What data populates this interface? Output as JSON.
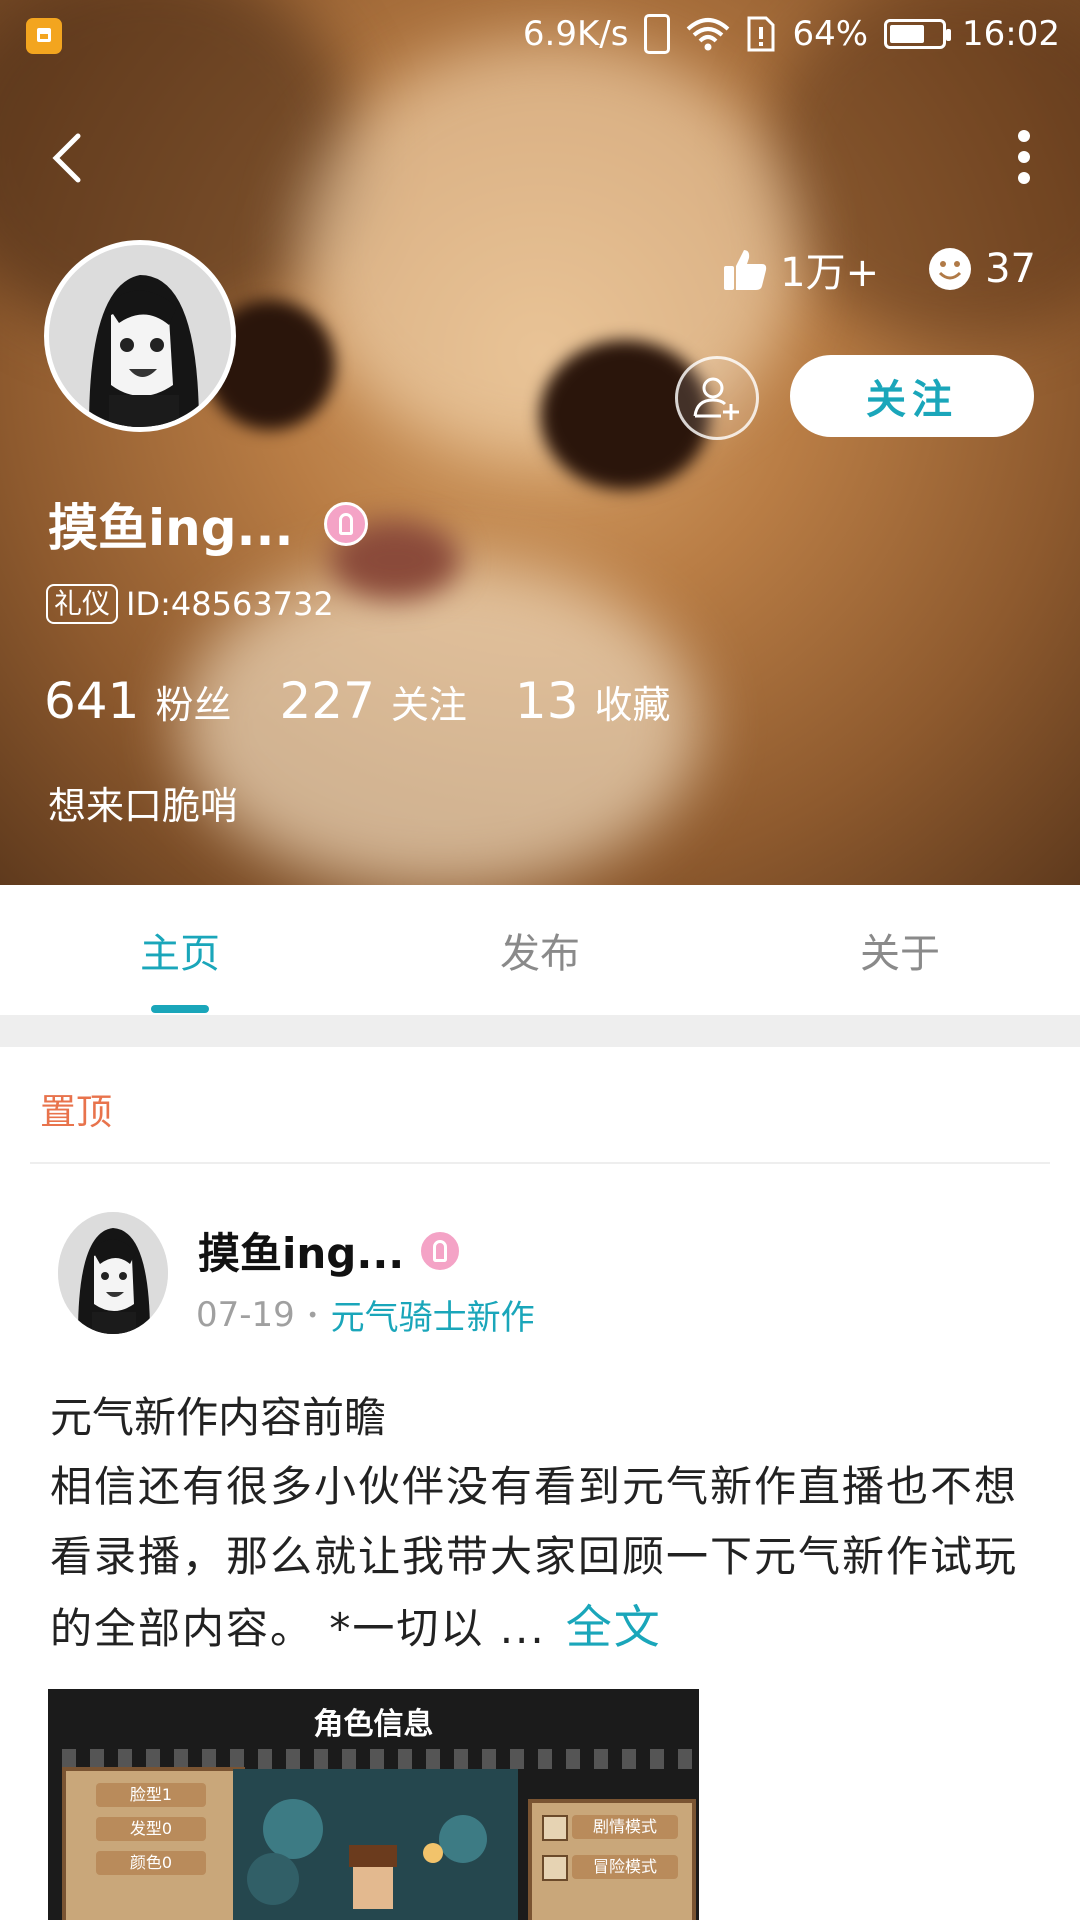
{
  "status_bar": {
    "net_speed": "6.9K/s",
    "battery": "64%",
    "time": "16:02"
  },
  "profile": {
    "likes": "1万+",
    "smiles": "37",
    "follow_label": "关注",
    "username": "摸鱼ing...",
    "id_tag": "礼仪",
    "id_text": "ID:48563732",
    "stats": [
      {
        "num": "641",
        "label": "粉丝"
      },
      {
        "num": "227",
        "label": "关注"
      },
      {
        "num": "13",
        "label": "收藏"
      }
    ],
    "bio": "想来口脆哨"
  },
  "tabs": [
    {
      "label": "主页",
      "active": true
    },
    {
      "label": "发布",
      "active": false
    },
    {
      "label": "关于",
      "active": false
    }
  ],
  "pinned_label": "置顶",
  "post": {
    "author": "摸鱼ing...",
    "date": "07-19",
    "game": "元气骑士新作",
    "title": "元气新作内容前瞻",
    "body": "相信还有很多小伙伴没有看到元气新作直播也不想看录播，那么就让我带大家回顾一下元气新作试玩的全部内容。 *一切以 ...",
    "more": "全文",
    "image": {
      "title": "角色信息",
      "left_buttons": [
        "脸型1",
        "发型0",
        "颜色0"
      ],
      "right_buttons": [
        "剧情模式",
        "冒险模式"
      ]
    }
  },
  "colors": {
    "accent": "#1aa6ba",
    "pinned": "#e8734c"
  }
}
